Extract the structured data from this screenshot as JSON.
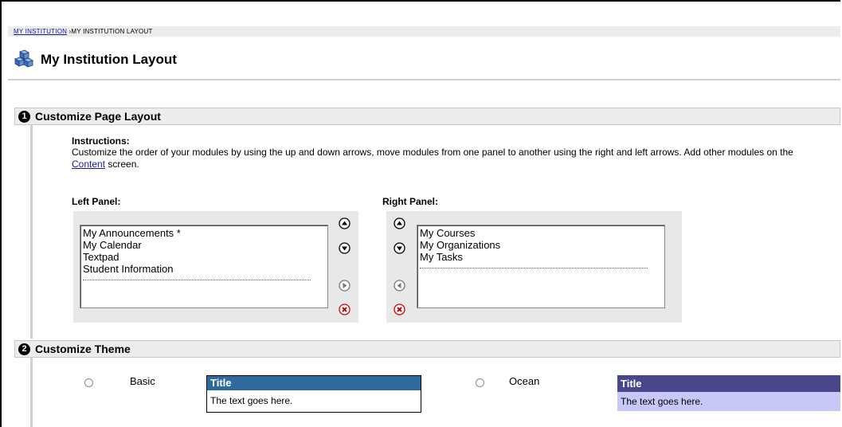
{
  "breadcrumb": {
    "link": "MY INSTITUTION",
    "sep": " ›",
    "current": "MY INSTITUTION LAYOUT"
  },
  "page": {
    "title": "My Institution Layout"
  },
  "section1": {
    "number": "1",
    "title": "Customize Page Layout",
    "instructions_heading": "Instructions:",
    "instructions_before": "Customize the order of your modules by using the up and down arrows, move modules from one panel to another using the right and left arrows. Add other modules on the ",
    "instructions_link": "Content",
    "instructions_after": " screen.",
    "left_panel": {
      "label": "Left Panel:",
      "items": [
        "My Announcements *",
        "My Calendar",
        "Textpad",
        "Student Information"
      ]
    },
    "right_panel": {
      "label": "Right Panel:",
      "items": [
        "My Courses",
        "My Organizations",
        "My Tasks"
      ]
    }
  },
  "section2": {
    "number": "2",
    "title": "Customize Theme",
    "themes": [
      {
        "name": "Basic",
        "preview_title": "Title",
        "preview_text": "The text goes here.",
        "header_color": "#2f6a9e",
        "body_color": "#ffffff",
        "selected": false
      },
      {
        "name": "Ocean",
        "preview_title": "Title",
        "preview_text": "The text goes here.",
        "header_color": "#47478a",
        "body_color": "#c8c8f6",
        "selected": false
      }
    ]
  },
  "icons": [
    "institution-cubes-icon",
    "move-up-icon",
    "move-down-icon",
    "move-right-icon",
    "move-left-icon",
    "remove-icon"
  ]
}
